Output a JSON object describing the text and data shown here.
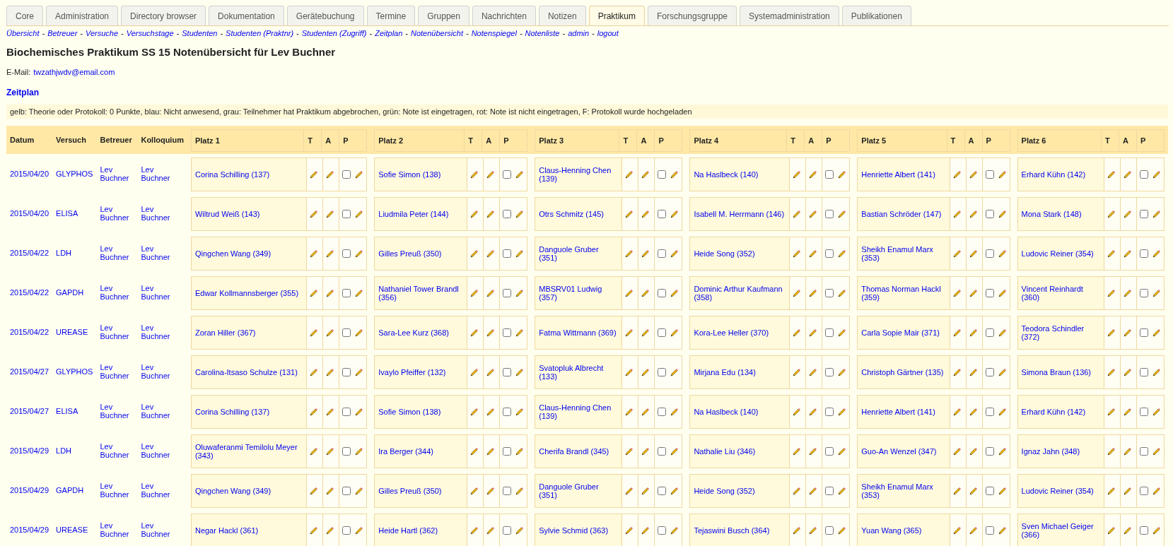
{
  "tabs": [
    {
      "label": "Core",
      "selected": false
    },
    {
      "label": "Administration",
      "selected": false
    },
    {
      "label": "Directory browser",
      "selected": false
    },
    {
      "label": "Dokumentation",
      "selected": false
    },
    {
      "label": "Gerätebuchung",
      "selected": false
    },
    {
      "label": "Termine",
      "selected": false
    },
    {
      "label": "Gruppen",
      "selected": false
    },
    {
      "label": "Nachrichten",
      "selected": false
    },
    {
      "label": "Notizen",
      "selected": false
    },
    {
      "label": "Praktikum",
      "selected": true
    },
    {
      "label": "Forschungsgruppe",
      "selected": false
    },
    {
      "label": "Systemadministration",
      "selected": false
    },
    {
      "label": "Publikationen",
      "selected": false
    }
  ],
  "nav": {
    "separator": "-",
    "links": [
      "Übersicht",
      "Betreuer",
      "Versuche",
      "Versuchstage",
      "Studenten",
      "Studenten (Praktnr)",
      "Studenten (Zugriff)",
      "Zeitplan",
      "Notenübersicht",
      "Notenspiegel",
      "Notenliste",
      "admin",
      "logout"
    ]
  },
  "title": "Biochemisches Praktikum SS 15 Notenübersicht für Lev Buchner",
  "email": {
    "label": "E-Mail:",
    "address": "twzathjwdv@email.com"
  },
  "section_link": "Zeitplan",
  "legend": "gelb: Theorie oder Protokoll: 0 Punkte, blau: Nicht anwesend, grau: Teilnehmer hat Praktikum abgebrochen, grün: Note ist eingetragen, rot: Note ist nicht eingetragen, F: Protokoll wurde hochgeladen",
  "table": {
    "columns": [
      "Datum",
      "Versuch",
      "Betreuer",
      "Kolloquium"
    ],
    "places": [
      {
        "label": "Platz 1",
        "sub": [
          "T",
          "A",
          "P"
        ]
      },
      {
        "label": "Platz 2",
        "sub": [
          "T",
          "A",
          "P"
        ]
      },
      {
        "label": "Platz 3",
        "sub": [
          "T",
          "A",
          "P"
        ]
      },
      {
        "label": "Platz 4",
        "sub": [
          "T",
          "A",
          "P"
        ]
      },
      {
        "label": "Platz 5",
        "sub": [
          "T",
          "A",
          "P"
        ]
      },
      {
        "label": "Platz 6",
        "sub": [
          "T",
          "A",
          "P"
        ]
      }
    ],
    "rows": [
      {
        "date": "2015/04/20",
        "versuch": "GLYPHOS",
        "betreuer": "Lev Buchner",
        "kolloquium": "Lev Buchner",
        "places": [
          {
            "student": "Corina Schilling (137)",
            "checked": false
          },
          {
            "student": "Sofie Simon (138)",
            "checked": false
          },
          {
            "student": "Claus-Henning Chen (139)",
            "checked": false
          },
          {
            "student": "Na Haslbeck (140)",
            "checked": false
          },
          {
            "student": "Henriette Albert (141)",
            "checked": false
          },
          {
            "student": "Erhard Kühn (142)",
            "checked": false
          }
        ]
      },
      {
        "date": "2015/04/20",
        "versuch": "ELISA",
        "betreuer": "Lev Buchner",
        "kolloquium": "Lev Buchner",
        "places": [
          {
            "student": "Wiltrud Weiß (143)",
            "checked": false
          },
          {
            "student": "Liudmila Peter (144)",
            "checked": false
          },
          {
            "student": "Otrs Schmitz (145)",
            "checked": false
          },
          {
            "student": "Isabell M. Herrmann (146)",
            "checked": false
          },
          {
            "student": "Bastian Schröder (147)",
            "checked": false
          },
          {
            "student": "Mona Stark (148)",
            "checked": false
          }
        ]
      },
      {
        "date": "2015/04/22",
        "versuch": "LDH",
        "betreuer": "Lev Buchner",
        "kolloquium": "Lev Buchner",
        "places": [
          {
            "student": "Qingchen Wang (349)",
            "checked": false
          },
          {
            "student": "Gilles Preuß (350)",
            "checked": false
          },
          {
            "student": "Danguole Gruber (351)",
            "checked": false
          },
          {
            "student": "Heide Song (352)",
            "checked": false
          },
          {
            "student": "Sheikh Enamul Marx (353)",
            "checked": false
          },
          {
            "student": "Ludovic Reiner (354)",
            "checked": false
          }
        ]
      },
      {
        "date": "2015/04/22",
        "versuch": "GAPDH",
        "betreuer": "Lev Buchner",
        "kolloquium": "Lev Buchner",
        "places": [
          {
            "student": "Edwar Kollmannsberger (355)",
            "checked": false
          },
          {
            "student": "Nathaniel Tower Brandl (356)",
            "checked": false
          },
          {
            "student": "MBSRV01 Ludwig (357)",
            "checked": false
          },
          {
            "student": "Dominic Arthur Kaufmann (358)",
            "checked": false
          },
          {
            "student": "Thomas Norman Hackl (359)",
            "checked": false
          },
          {
            "student": "Vincent Reinhardt (360)",
            "checked": false
          }
        ]
      },
      {
        "date": "2015/04/22",
        "versuch": "UREASE",
        "betreuer": "Lev Buchner",
        "kolloquium": "Lev Buchner",
        "places": [
          {
            "student": "Zoran Hiller (367)",
            "checked": false
          },
          {
            "student": "Sara-Lee Kurz (368)",
            "checked": false
          },
          {
            "student": "Fatma Wittmann (369)",
            "checked": false
          },
          {
            "student": "Kora-Lee Heller (370)",
            "checked": false
          },
          {
            "student": "Carla Sopie Mair (371)",
            "checked": false
          },
          {
            "student": "Teodora Schindler (372)",
            "checked": false
          }
        ]
      },
      {
        "date": "2015/04/27",
        "versuch": "GLYPHOS",
        "betreuer": "Lev Buchner",
        "kolloquium": "Lev Buchner",
        "places": [
          {
            "student": "Carolina-Itsaso Schulze (131)",
            "checked": false
          },
          {
            "student": "Ivaylo Pfeiffer (132)",
            "checked": false
          },
          {
            "student": "Svatopluk Albrecht (133)",
            "checked": false
          },
          {
            "student": "Mirjana Edu (134)",
            "checked": false
          },
          {
            "student": "Christoph Gärtner (135)",
            "checked": false
          },
          {
            "student": "Simona Braun (136)",
            "checked": false
          }
        ]
      },
      {
        "date": "2015/04/27",
        "versuch": "ELISA",
        "betreuer": "Lev Buchner",
        "kolloquium": "Lev Buchner",
        "places": [
          {
            "student": "Corina Schilling (137)",
            "checked": false
          },
          {
            "student": "Sofie Simon (138)",
            "checked": false
          },
          {
            "student": "Claus-Henning Chen (139)",
            "checked": false
          },
          {
            "student": "Na Haslbeck (140)",
            "checked": false
          },
          {
            "student": "Henriette Albert (141)",
            "checked": false
          },
          {
            "student": "Erhard Kühn (142)",
            "checked": false
          }
        ]
      },
      {
        "date": "2015/04/29",
        "versuch": "LDH",
        "betreuer": "Lev Buchner",
        "kolloquium": "Lev Buchner",
        "places": [
          {
            "student": "Oluwaferanmi Temilolu Meyer (343)",
            "checked": false
          },
          {
            "student": "Ira Berger (344)",
            "checked": false
          },
          {
            "student": "Cherifa Brandl (345)",
            "checked": false
          },
          {
            "student": "Nathalie Liu (346)",
            "checked": false
          },
          {
            "student": "Guo-An Wenzel (347)",
            "checked": false
          },
          {
            "student": "Ignaz Jahn (348)",
            "checked": false
          }
        ]
      },
      {
        "date": "2015/04/29",
        "versuch": "GAPDH",
        "betreuer": "Lev Buchner",
        "kolloquium": "Lev Buchner",
        "places": [
          {
            "student": "Qingchen Wang (349)",
            "checked": false
          },
          {
            "student": "Gilles Preuß (350)",
            "checked": false
          },
          {
            "student": "Danguole Gruber (351)",
            "checked": false
          },
          {
            "student": "Heide Song (352)",
            "checked": false
          },
          {
            "student": "Sheikh Enamul Marx (353)",
            "checked": false
          },
          {
            "student": "Ludovic Reiner (354)",
            "checked": false
          }
        ]
      },
      {
        "date": "2015/04/29",
        "versuch": "UREASE",
        "betreuer": "Lev Buchner",
        "kolloquium": "Lev Buchner",
        "places": [
          {
            "student": "Negar Hackl (361)",
            "checked": false
          },
          {
            "student": "Heide Hartl (362)",
            "checked": false
          },
          {
            "student": "Sylvie Schmid (363)",
            "checked": false
          },
          {
            "student": "Tejaswini Busch (364)",
            "checked": false
          },
          {
            "student": "Yuan Wang (365)",
            "checked": false
          },
          {
            "student": "Sven Michael Geiger (366)",
            "checked": false
          }
        ]
      }
    ]
  }
}
